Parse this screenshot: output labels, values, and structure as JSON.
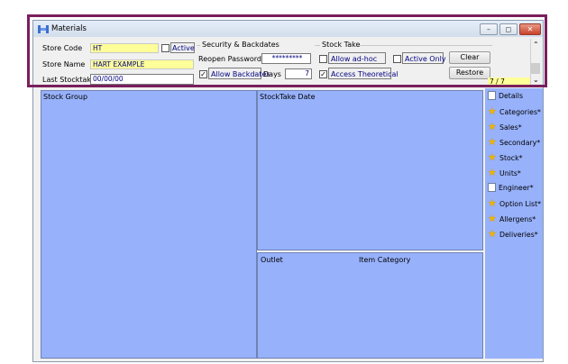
{
  "window": {
    "title": "Materials",
    "minimize_symbol": "–",
    "maximize_symbol": "◻",
    "close_symbol": "✕"
  },
  "store": {
    "code_label": "Store Code",
    "code_value": "HT",
    "active_label": "Active",
    "active_checked": false,
    "name_label": "Store Name",
    "name_value": "HART EXAMPLE",
    "last_stocktake_label": "Last Stocktake",
    "last_stocktake_value": "00/00/00"
  },
  "security": {
    "heading": "Security & Backdates",
    "reopen_password_label": "Reopen Password",
    "reopen_password_value": "*********",
    "allow_backdates_label": "Allow Backdates",
    "allow_backdates_checked": true,
    "days_label": "Days",
    "days_value": "7"
  },
  "stock_take": {
    "heading": "Stock Take",
    "allow_adhoc_label": "Allow ad-hoc",
    "allow_adhoc_checked": false,
    "active_only_label": "Active Only",
    "active_only_checked": false,
    "access_theoretical_label": "Access Theoretical",
    "access_theoretical_checked": true,
    "clear_label": "Clear",
    "restore_label": "Restore"
  },
  "record_counter": "7 / 7",
  "panels": {
    "stock_group": "Stock Group",
    "stocktake_date": "StockTake Date",
    "outlet": "Outlet",
    "item_category": "Item Category"
  },
  "sidebar": {
    "items": [
      {
        "label": "Details",
        "icon": "document-icon"
      },
      {
        "label": "Categories*",
        "icon": "star-icon"
      },
      {
        "label": "Sales*",
        "icon": "star-icon"
      },
      {
        "label": "Secondary*",
        "icon": "star-icon"
      },
      {
        "label": "Stock*",
        "icon": "star-icon"
      },
      {
        "label": "Units*",
        "icon": "star-icon"
      },
      {
        "label": "Engineer*",
        "icon": "document-icon"
      },
      {
        "label": "Option List*",
        "icon": "star-icon"
      },
      {
        "label": "Allergens*",
        "icon": "star-icon"
      },
      {
        "label": "Deliveries*",
        "icon": "star-icon"
      }
    ]
  },
  "colors": {
    "panel_blue": "#97b1fb",
    "field_yellow": "#ffff99",
    "highlight_frame": "#7a1f5c"
  }
}
